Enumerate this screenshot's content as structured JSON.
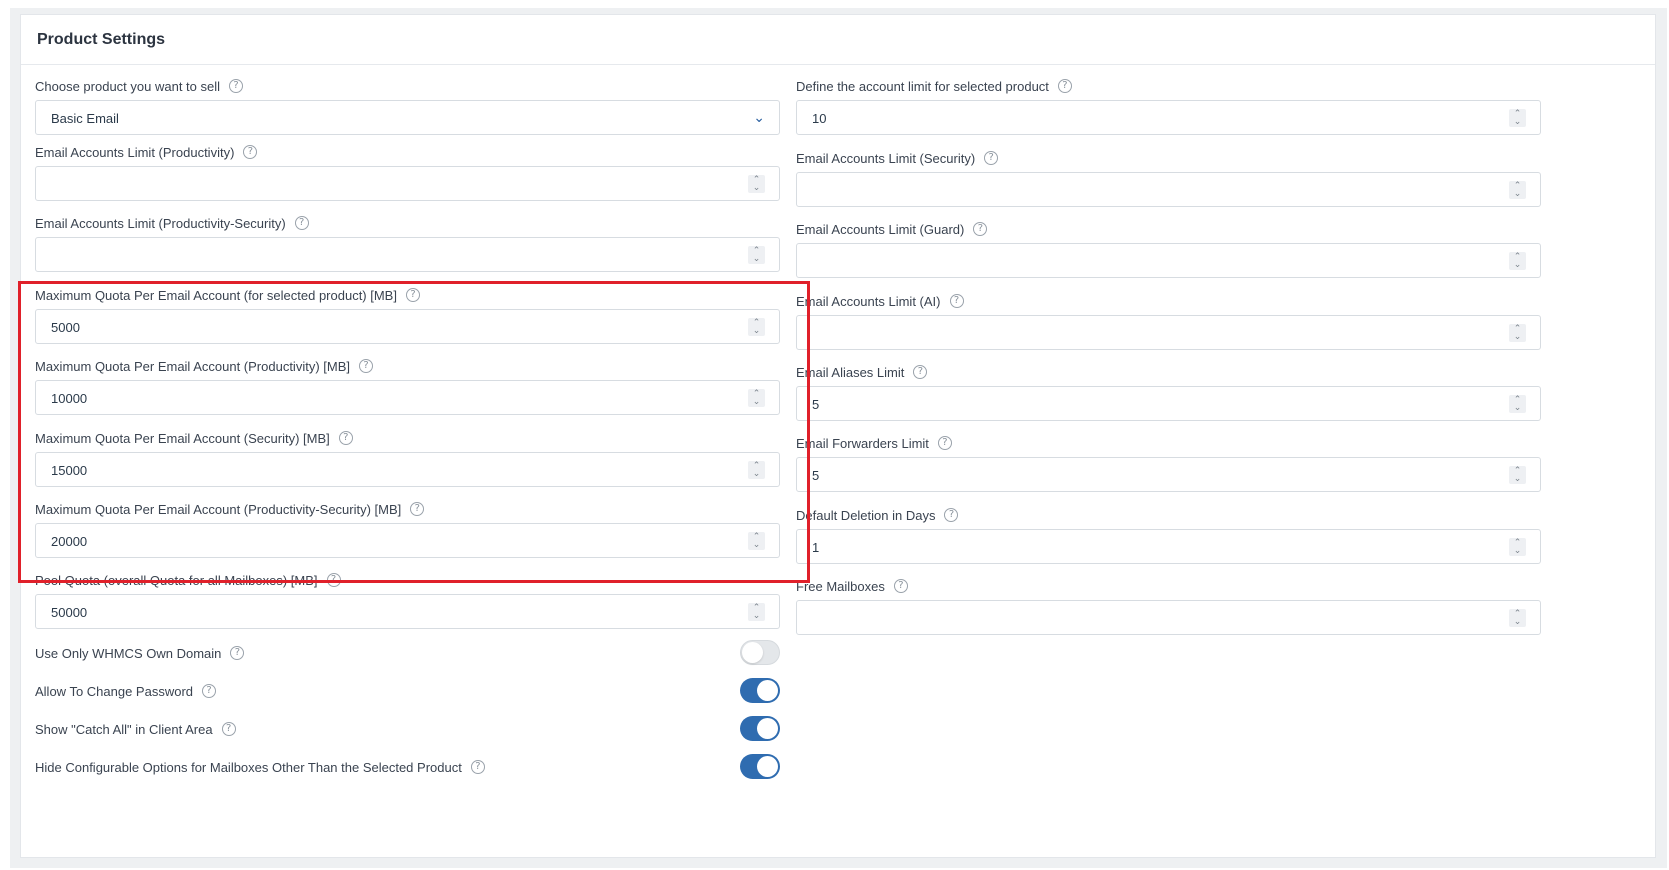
{
  "panel": {
    "title": "Product Settings"
  },
  "left": {
    "product": {
      "label": "Choose product you want to sell",
      "value": "Basic Email"
    },
    "limit_productivity": {
      "label": "Email Accounts Limit (Productivity)",
      "value": ""
    },
    "limit_prod_security": {
      "label": "Email Accounts Limit (Productivity-Security)",
      "value": ""
    },
    "quota_selected": {
      "label": "Maximum Quota Per Email Account (for selected product) [MB]",
      "value": "5000"
    },
    "quota_productivity": {
      "label": "Maximum Quota Per Email Account (Productivity) [MB]",
      "value": "10000"
    },
    "quota_security": {
      "label": "Maximum Quota Per Email Account (Security) [MB]",
      "value": "15000"
    },
    "quota_prod_security": {
      "label": "Maximum Quota Per Email Account (Productivity-Security) [MB]",
      "value": "20000"
    },
    "pool_quota": {
      "label": "Pool Quota (overall Quota for all Mailboxes) [MB]",
      "value": "50000"
    }
  },
  "right": {
    "account_limit": {
      "label": "Define the account limit for selected product",
      "value": "10"
    },
    "limit_security": {
      "label": "Email Accounts Limit (Security)",
      "value": ""
    },
    "limit_guard": {
      "label": "Email Accounts Limit (Guard)",
      "value": ""
    },
    "limit_ai": {
      "label": "Email Accounts Limit (AI)",
      "value": ""
    },
    "aliases": {
      "label": "Email Aliases Limit",
      "value": "5"
    },
    "forwarders": {
      "label": "Email Forwarders Limit",
      "value": "5"
    },
    "deletion_days": {
      "label": "Default Deletion in Days",
      "value": "1"
    },
    "free_mailboxes": {
      "label": "Free Mailboxes",
      "value": ""
    }
  },
  "toggles": [
    {
      "label": "Use Only WHMCS Own Domain",
      "on": false
    },
    {
      "label": "Allow To Change Password",
      "on": true
    },
    {
      "label": "Show \"Catch All\" in Client Area",
      "on": true
    },
    {
      "label": "Hide Configurable Options for Mailboxes Other Than the Selected Product",
      "on": true
    }
  ],
  "icons": {
    "help": "question-circle-icon",
    "dropdown": "chevron-down-icon",
    "spinner": "number-spinner-icon"
  },
  "colors": {
    "accent": "#2f6cb0",
    "highlight": "#e0202a"
  }
}
